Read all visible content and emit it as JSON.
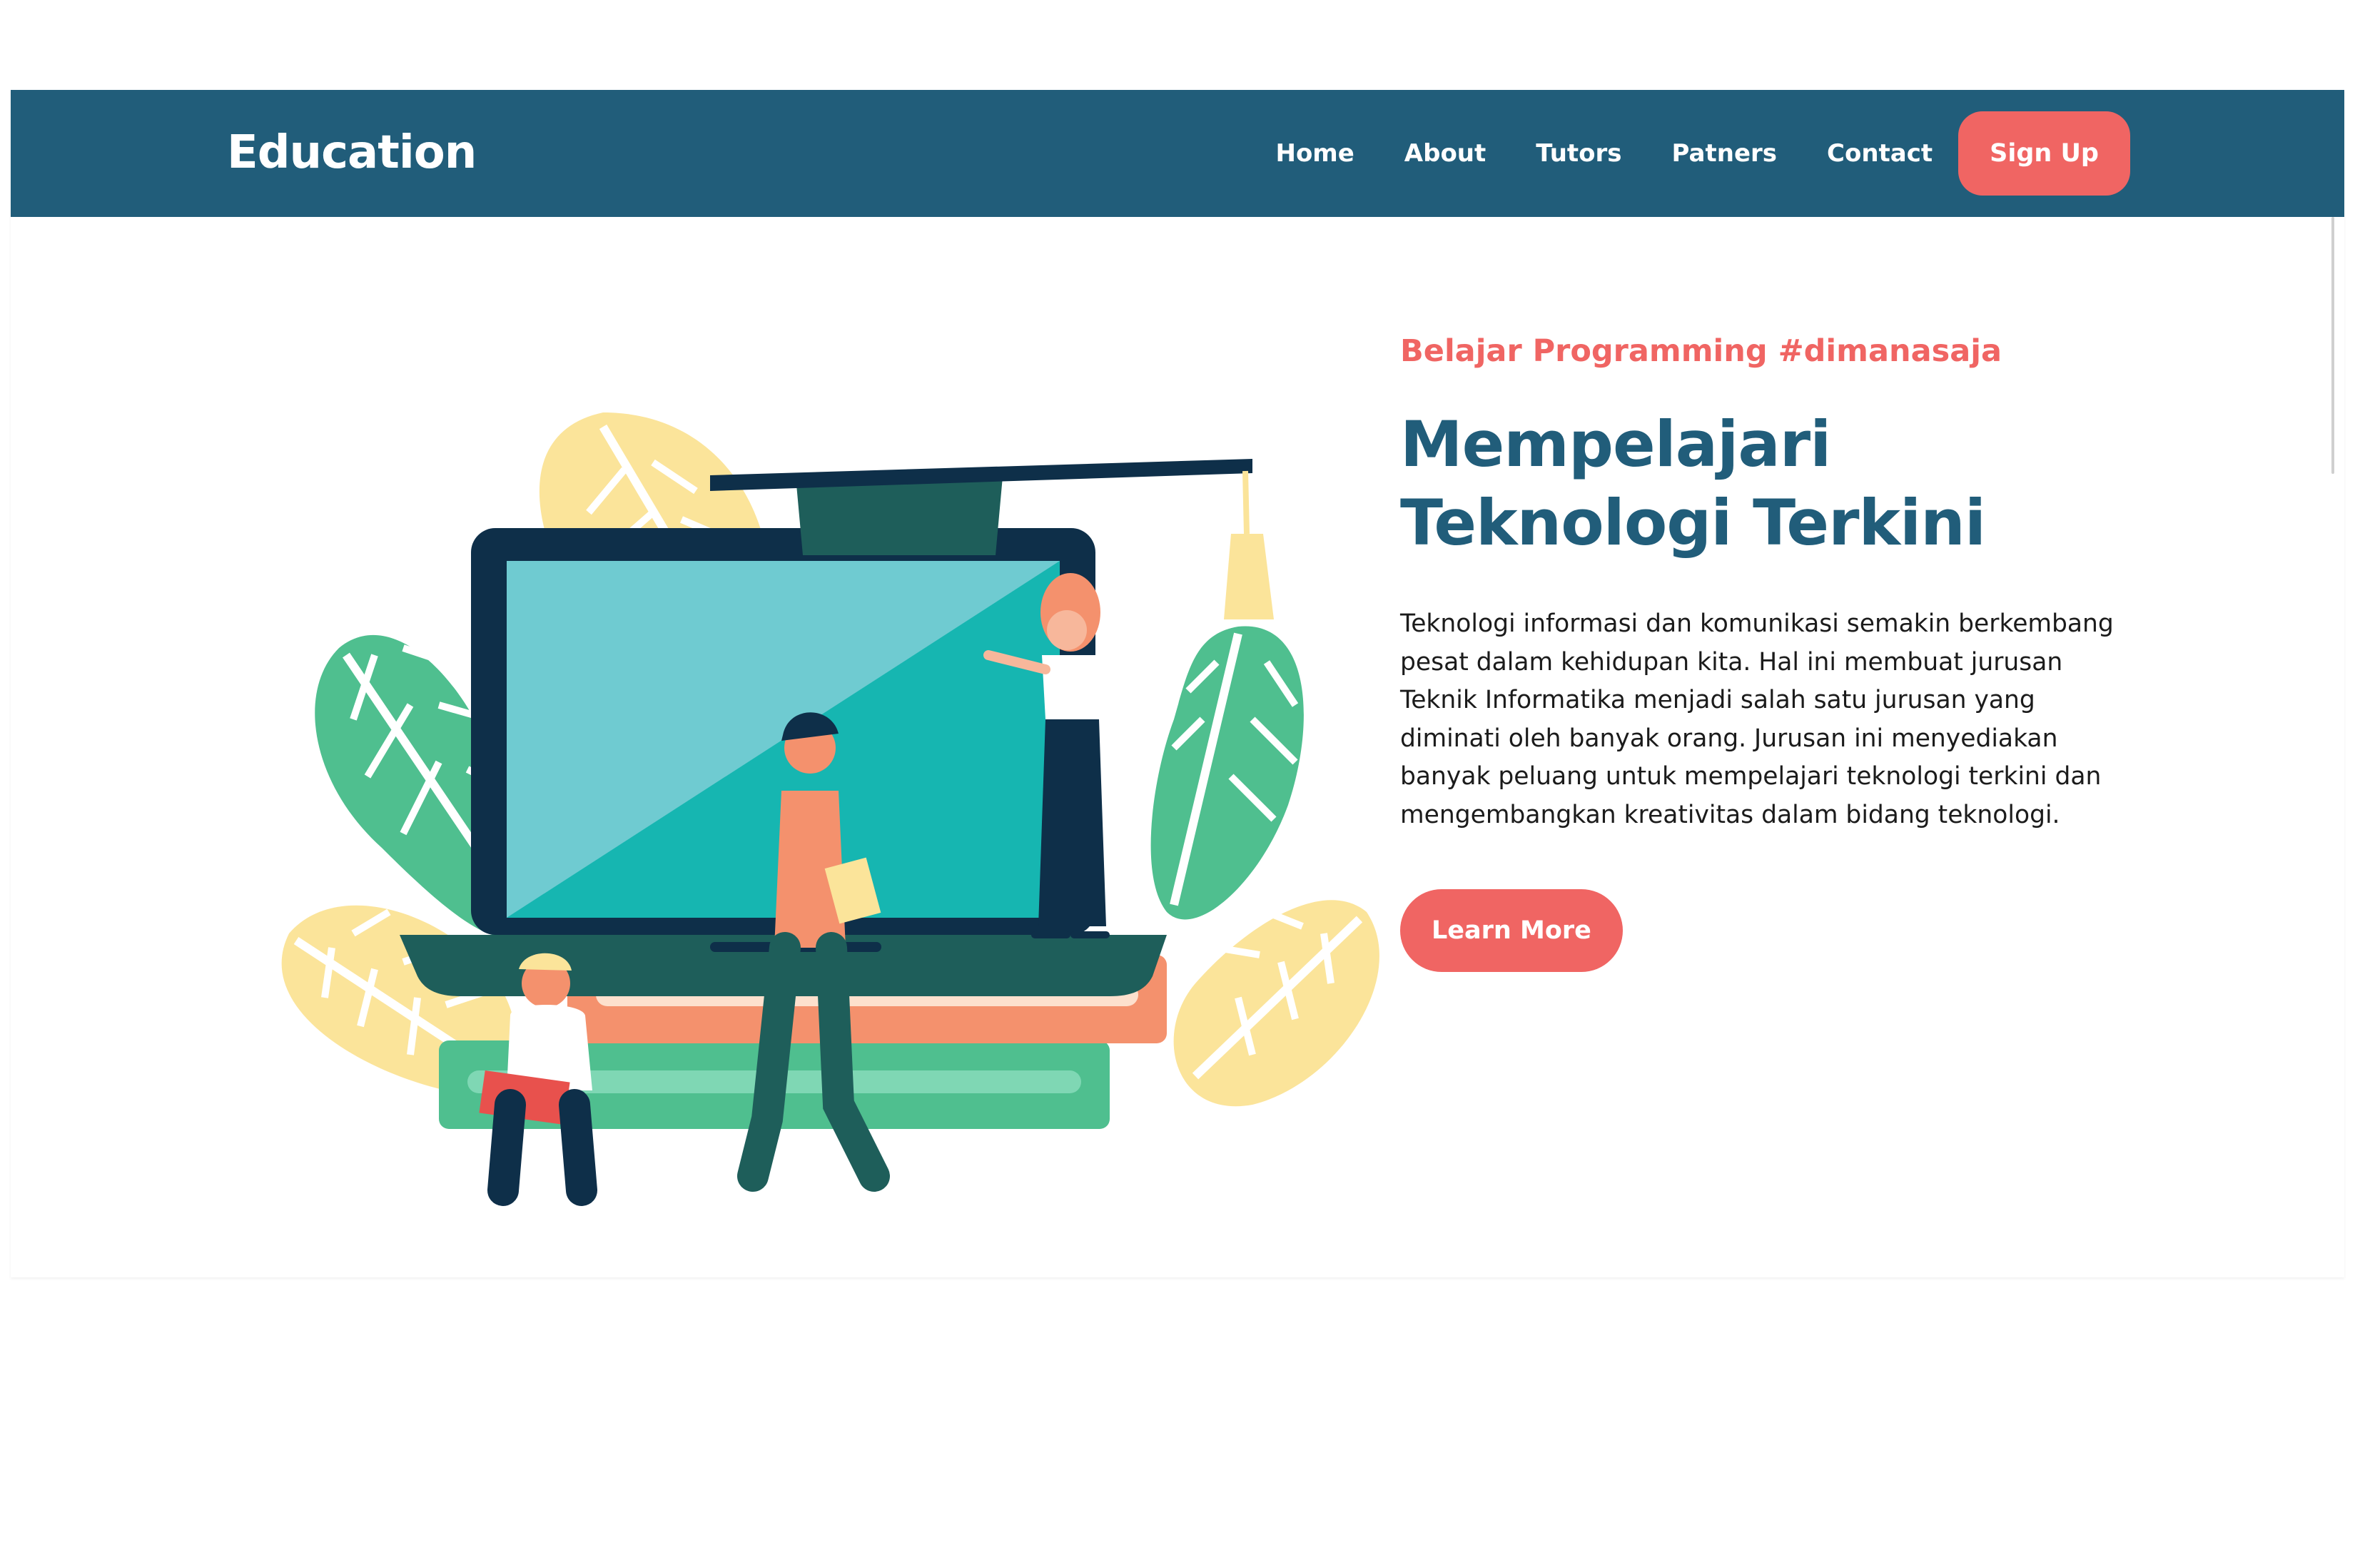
{
  "navbar": {
    "brand": "Education",
    "links": [
      "Home",
      "About",
      "Tutors",
      "Patners",
      "Contact"
    ],
    "signup_label": "Sign Up"
  },
  "hero": {
    "tagline": "Belajar Programming #dimanasaja",
    "headline_line1": "Mempelajari",
    "headline_line2": "Teknologi Terkini",
    "description": "Teknologi informasi dan komunikasi semakin berkembang pesat dalam kehidupan kita. Hal ini membuat jurusan Teknik Informatika menjadi salah satu jurusan yang diminati oleh banyak orang. Jurusan ini menyediakan banyak peluang untuk mempelajari teknologi terkini dan mengembangkan kreativitas dalam bidang teknologi.",
    "cta_label": "Learn More"
  },
  "colors": {
    "navbar_bg": "#215d7a",
    "accent": "#f06563",
    "headline": "#215d7a"
  }
}
